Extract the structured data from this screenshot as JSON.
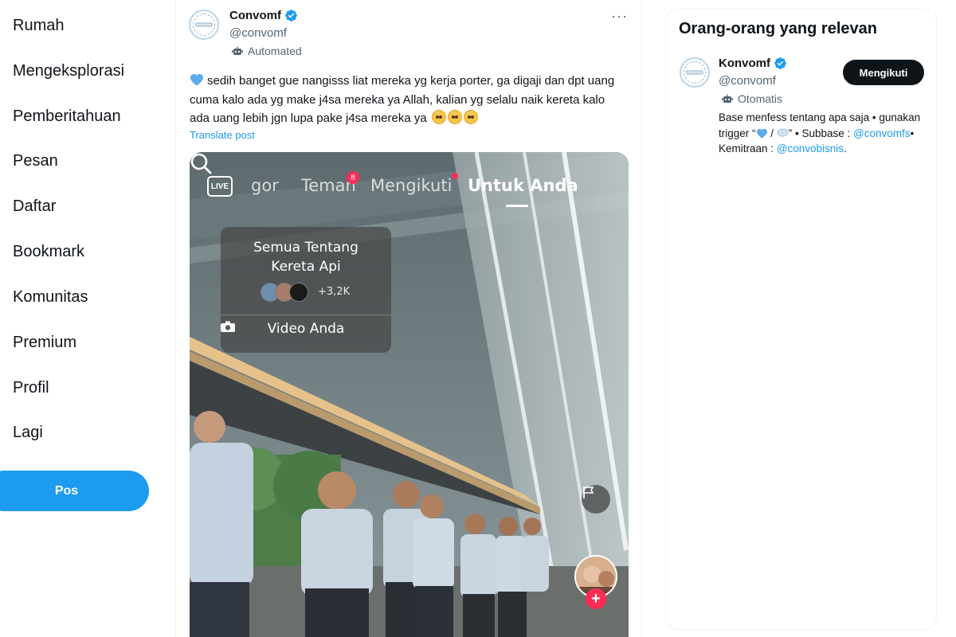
{
  "nav": {
    "items": [
      {
        "label": "Rumah",
        "icon": "home-icon"
      },
      {
        "label": "Mengeksplorasi",
        "icon": "explore-icon"
      },
      {
        "label": "Pemberitahuan",
        "icon": "bell-icon"
      },
      {
        "label": "Pesan",
        "icon": "mail-icon"
      },
      {
        "label": "Daftar",
        "icon": "list-icon"
      },
      {
        "label": "Bookmark",
        "icon": "bookmark-icon"
      },
      {
        "label": "Komunitas",
        "icon": "people-icon"
      },
      {
        "label": "Premium",
        "icon": "premium-icon"
      },
      {
        "label": "Profil",
        "icon": "user-icon"
      },
      {
        "label": "Lagi",
        "icon": "more-icon"
      }
    ],
    "post_button": "Pos"
  },
  "post": {
    "author_name": "Convomf",
    "handle": "@convomf",
    "automated_label": "Automated",
    "text": "sedih banget gue nangisss liat mereka yg kerja porter, ga digaji dan dpt uang cuma kalo ada yg make j4sa mereka ya Allah, kalian yg selalu naik kereta kalo ada uang lebih jgn lupa pake j4sa mereka ya",
    "translate_label": "Translate post",
    "more_label": "···",
    "media": {
      "live_label": "LIVE",
      "tabs": [
        "gor",
        "Teman",
        "Mengikuti",
        "Untuk Anda"
      ],
      "teman_badge": "8",
      "overlay_title_line1": "Semua Tentang",
      "overlay_title_line2": "Kereta Api",
      "overlay_count": "+3,2K",
      "overlay_video_label": "Video Anda",
      "plus_label": "+"
    }
  },
  "relevant": {
    "title": "Orang-orang yang relevan",
    "name": "Konvomf",
    "handle": "@convomf",
    "automated_label": "Otomatis",
    "follow_button": "Mengikuti",
    "bio_part1": "Base menfess tentang apa saja • gunakan trigger “",
    "bio_part2": " / ",
    "bio_part3": "” • Subbase : ",
    "bio_link1": "@convomfs",
    "bio_part4": "• Kemitraan : ",
    "bio_link2": "@convobisnis",
    "bio_part5": "."
  },
  "colors": {
    "accent": "#1d9bf0",
    "text": "#0f1419",
    "secondary": "#536471",
    "follow_bg": "#0f1419",
    "tiktok_red": "#fe2c55"
  }
}
